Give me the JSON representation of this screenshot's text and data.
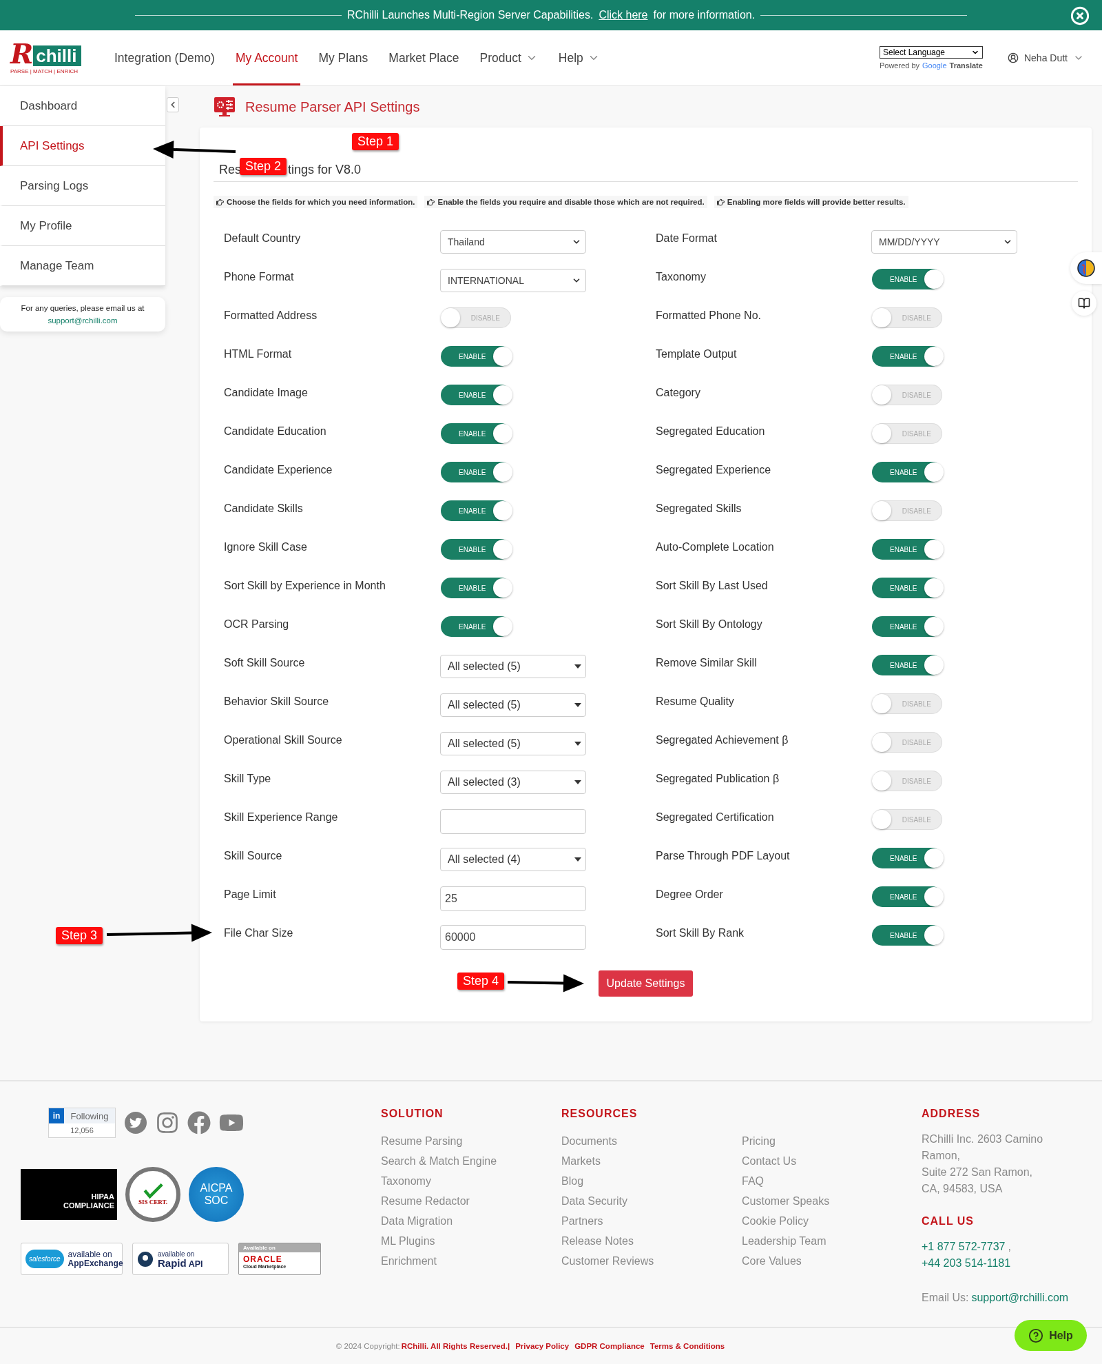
{
  "banner": {
    "text": "RChilli Launches Multi-Region Server Capabilities.",
    "link": "Click here",
    "tail": "for more information."
  },
  "logo": {
    "letter": "R",
    "rest": "chilli",
    "tagline": "PARSE | MATCH | ENRICH"
  },
  "nav": [
    {
      "label": "Integration (Demo)",
      "selected": false,
      "has_menu": false
    },
    {
      "label": "My Account",
      "selected": true,
      "has_menu": false
    },
    {
      "label": "My Plans",
      "selected": false,
      "has_menu": false
    },
    {
      "label": "Market Place",
      "selected": false,
      "has_menu": false
    },
    {
      "label": "Product",
      "selected": false,
      "has_menu": true
    },
    {
      "label": "Help",
      "selected": false,
      "has_menu": true
    }
  ],
  "translate": {
    "select": "Select Language",
    "powered": "Powered by",
    "google": "Google",
    "translate": "Translate"
  },
  "user": {
    "name": "Neha Dutt"
  },
  "sidebar": {
    "items": [
      {
        "label": "Dashboard",
        "selected": false
      },
      {
        "label": "API Settings",
        "selected": true
      },
      {
        "label": "Parsing Logs",
        "selected": false
      },
      {
        "label": "My Profile",
        "selected": false
      },
      {
        "label": "Manage Team",
        "selected": false
      }
    ],
    "help_text": "For any queries, please email us at",
    "help_email": "support@rchilli.com"
  },
  "page_title": "Resume Parser API Settings",
  "heading": {
    "start": "Res",
    "end": "tings for V8.0"
  },
  "hints": [
    "Choose the fields for which you need information.",
    "Enable the fields you require and disable those which are not required.",
    "Enabling more fields will provide better results."
  ],
  "rows": [
    {
      "left": {
        "label": "Default Country",
        "kind": "select",
        "value": "Thailand"
      },
      "right": {
        "label": "Date Format",
        "kind": "select",
        "value": "MM/DD/YYYY"
      }
    },
    {
      "left": {
        "label": "Phone Format",
        "kind": "select",
        "value": "INTERNATIONAL"
      },
      "right": {
        "label": "Taxonomy",
        "kind": "toggle",
        "on": true,
        "text": "ENABLE"
      }
    },
    {
      "left": {
        "label": "Formatted Address",
        "kind": "toggle",
        "on": false,
        "text": "DISABLE"
      },
      "right": {
        "label": "Formatted Phone No.",
        "kind": "toggle",
        "on": false,
        "text": "DISABLE"
      }
    },
    {
      "left": {
        "label": "HTML Format",
        "kind": "toggle",
        "on": true,
        "text": "ENABLE"
      },
      "right": {
        "label": "Template Output",
        "kind": "toggle",
        "on": true,
        "text": "ENABLE"
      }
    },
    {
      "left": {
        "label": "Candidate Image",
        "kind": "toggle",
        "on": true,
        "text": "ENABLE"
      },
      "right": {
        "label": "Category",
        "kind": "toggle",
        "on": false,
        "text": "DISABLE"
      }
    },
    {
      "left": {
        "label": "Candidate Education",
        "kind": "toggle",
        "on": true,
        "text": "ENABLE"
      },
      "right": {
        "label": "Segregated Education",
        "kind": "toggle",
        "on": false,
        "text": "DISABLE"
      }
    },
    {
      "left": {
        "label": "Candidate Experience",
        "kind": "toggle",
        "on": true,
        "text": "ENABLE"
      },
      "right": {
        "label": "Segregated Experience",
        "kind": "toggle",
        "on": true,
        "text": "ENABLE"
      }
    },
    {
      "left": {
        "label": "Candidate Skills",
        "kind": "toggle",
        "on": true,
        "text": "ENABLE"
      },
      "right": {
        "label": "Segregated Skills",
        "kind": "toggle",
        "on": false,
        "text": "DISABLE"
      }
    },
    {
      "left": {
        "label": "Ignore Skill Case",
        "kind": "toggle",
        "on": true,
        "text": "ENABLE"
      },
      "right": {
        "label": "Auto-Complete Location",
        "kind": "toggle",
        "on": true,
        "text": "ENABLE"
      }
    },
    {
      "left": {
        "label": "Sort Skill by Experience in Month",
        "kind": "toggle",
        "on": true,
        "text": "ENABLE"
      },
      "right": {
        "label": "Sort Skill By Last Used",
        "kind": "toggle",
        "on": true,
        "text": "ENABLE"
      }
    },
    {
      "left": {
        "label": "OCR Parsing",
        "kind": "toggle",
        "on": true,
        "text": "ENABLE"
      },
      "right": {
        "label": "Sort Skill By Ontology",
        "kind": "toggle",
        "on": true,
        "text": "ENABLE"
      }
    },
    {
      "left": {
        "label": "Soft Skill Source",
        "kind": "multiselect",
        "value": "All selected (5)"
      },
      "right": {
        "label": "Remove Similar Skill",
        "kind": "toggle",
        "on": true,
        "text": "ENABLE"
      }
    },
    {
      "left": {
        "label": "Behavior Skill Source",
        "kind": "multiselect",
        "value": "All selected (5)"
      },
      "right": {
        "label": "Resume Quality",
        "kind": "toggle",
        "on": false,
        "text": "DISABLE"
      }
    },
    {
      "left": {
        "label": "Operational Skill Source",
        "kind": "multiselect",
        "value": "All selected (5)"
      },
      "right": {
        "label": "Segregated Achievement β",
        "kind": "toggle",
        "on": false,
        "text": "DISABLE"
      }
    },
    {
      "left": {
        "label": "Skill Type",
        "kind": "multiselect",
        "value": "All selected (3)"
      },
      "right": {
        "label": "Segregated Publication β",
        "kind": "toggle",
        "on": false,
        "text": "DISABLE"
      }
    },
    {
      "left": {
        "label": "Skill Experience Range",
        "kind": "input"
      },
      "right": {
        "label": "Segregated Certification",
        "kind": "toggle",
        "on": false,
        "text": "DISABLE"
      }
    },
    {
      "left": {
        "label": "Skill Source",
        "kind": "multiselect",
        "value": "All selected (4)"
      },
      "right": {
        "label": "Parse Through PDF Layout",
        "kind": "toggle",
        "on": true,
        "text": "ENABLE"
      }
    },
    {
      "left": {
        "label": "Page Limit",
        "kind": "input",
        "value": "25"
      },
      "right": {
        "label": "Degree Order",
        "kind": "toggle",
        "on": true,
        "text": "ENABLE"
      }
    },
    {
      "left": {
        "label": "File Char Size",
        "kind": "input",
        "value": "60000"
      },
      "right": {
        "label": "Sort Skill By Rank",
        "kind": "toggle",
        "on": true,
        "text": "ENABLE"
      }
    }
  ],
  "update_button": "Update Settings",
  "steps": [
    "Step 1",
    "Step 2",
    "Step 3",
    "Step 4"
  ],
  "footer": {
    "linkedin": {
      "logo": "in",
      "label": "Following",
      "count": "12,056"
    },
    "certifications": [
      {
        "kind": "hipaa",
        "main": "HIPAA",
        "sub": "COMPLIANCE"
      },
      {
        "kind": "iso",
        "main": "SIS CERT."
      },
      {
        "kind": "aicpa",
        "main": "AICPA",
        "sub": "SOC"
      }
    ],
    "stores": [
      {
        "kind": "salesforce",
        "logo_text": "salesforce",
        "top": "available on",
        "main": "AppExchange"
      },
      {
        "kind": "rapidapi",
        "top": "available on",
        "main": "Rapid",
        "suffix": "API"
      },
      {
        "kind": "oracle",
        "top": "Available on",
        "main": "ORACLE",
        "suffix": "Cloud Marketplace"
      }
    ],
    "columns": [
      {
        "title": "SOLUTION",
        "links": [
          "Resume Parsing",
          "Search & Match Engine",
          "Taxonomy",
          "Resume Redactor",
          "Data Migration",
          "ML Plugins",
          "Enrichment"
        ]
      },
      {
        "title": "RESOURCES",
        "links": [
          "Documents",
          "Markets",
          "Blog",
          "Data Security",
          "Partners",
          "Release Notes",
          "Customer Reviews"
        ]
      },
      {
        "links": [
          "Pricing",
          "Contact Us",
          "FAQ",
          "Customer Speaks",
          "Cookie Policy",
          "Leadership Team",
          "Core Values"
        ]
      }
    ],
    "address": {
      "title": "ADDRESS",
      "lines": [
        "RChilli Inc. 2603 Camino",
        "Ramon,",
        "Suite 272 San Ramon,",
        "CA, 94583, USA"
      ]
    },
    "call": {
      "title": "CALL US",
      "phones": [
        "+1 877 572-7737",
        "+44 203 514-1181"
      ],
      "separator": ","
    },
    "email": {
      "label": "Email Us:",
      "value": "support@rchilli.com"
    },
    "copyright": {
      "prefix": "© 2024 Copyright:",
      "owner": "RChilli. All Rights Reserved.|",
      "links": [
        "Privacy Policy",
        "GDPR Compliance",
        "Terms & Conditions"
      ]
    }
  },
  "help_button": "Help"
}
